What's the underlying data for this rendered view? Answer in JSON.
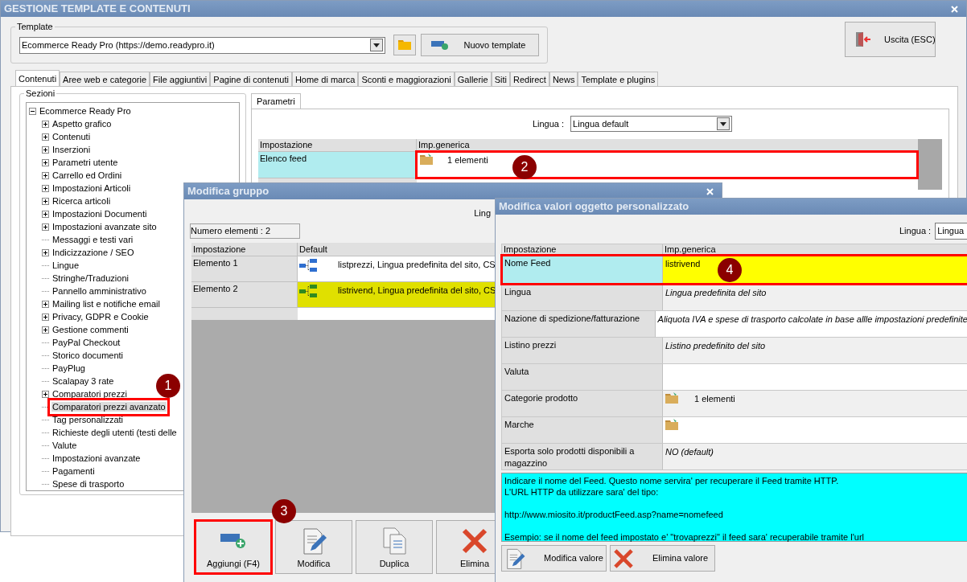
{
  "main_window": {
    "title": "GESTIONE TEMPLATE E CONTENUTI",
    "template": {
      "label": "Template",
      "value": "Ecommerce Ready Pro (https://demo.readypro.it)",
      "new_button": "Nuovo template"
    },
    "exit_button": "Uscita (ESC)",
    "tabs": [
      {
        "label": "Contenuti",
        "selected": true
      },
      {
        "label": "Aree web e categorie",
        "selected": false
      },
      {
        "label": "File aggiuntivi",
        "selected": false
      },
      {
        "label": "Pagine di contenuti",
        "selected": false
      },
      {
        "label": "Home di marca",
        "selected": false
      },
      {
        "label": "Sconti e maggiorazioni",
        "selected": false
      },
      {
        "label": "Gallerie",
        "selected": false
      },
      {
        "label": "Siti",
        "selected": false
      },
      {
        "label": "Redirect",
        "selected": false
      },
      {
        "label": "News",
        "selected": false
      },
      {
        "label": "Template e plugins",
        "selected": false
      }
    ],
    "sections": {
      "label": "Sezioni",
      "tree": {
        "label": "Ecommerce Ready Pro",
        "expanded": true,
        "children": [
          {
            "label": "Aspetto grafico",
            "kind": "branch",
            "selected": false
          },
          {
            "label": "Contenuti",
            "kind": "branch",
            "selected": false
          },
          {
            "label": "Inserzioni",
            "kind": "branch",
            "selected": false
          },
          {
            "label": "Parametri utente",
            "kind": "branch",
            "selected": false
          },
          {
            "label": "Carrello ed Ordini",
            "kind": "branch",
            "selected": false
          },
          {
            "label": "Impostazioni Articoli",
            "kind": "branch",
            "selected": false
          },
          {
            "label": "Ricerca articoli",
            "kind": "branch",
            "selected": false
          },
          {
            "label": "Impostazioni Documenti",
            "kind": "branch",
            "selected": false
          },
          {
            "label": "Impostazioni avanzate sito",
            "kind": "branch",
            "selected": false
          },
          {
            "label": "Messaggi e testi vari",
            "kind": "leaf",
            "selected": false
          },
          {
            "label": "Indicizzazione / SEO",
            "kind": "branch",
            "selected": false
          },
          {
            "label": "Lingue",
            "kind": "leaf",
            "selected": false
          },
          {
            "label": "Stringhe/Traduzioni",
            "kind": "leaf",
            "selected": false
          },
          {
            "label": "Pannello amministrativo",
            "kind": "leaf",
            "selected": false
          },
          {
            "label": "Mailing list e notifiche email",
            "kind": "branch",
            "selected": false
          },
          {
            "label": "Privacy, GDPR e Cookie",
            "kind": "branch",
            "selected": false
          },
          {
            "label": "Gestione commenti",
            "kind": "branch",
            "selected": false
          },
          {
            "label": "PayPal Checkout",
            "kind": "leaf",
            "selected": false
          },
          {
            "label": "Storico documenti",
            "kind": "leaf",
            "selected": false
          },
          {
            "label": "PayPlug",
            "kind": "leaf",
            "selected": false
          },
          {
            "label": "Scalapay 3 rate",
            "kind": "leaf",
            "selected": false
          },
          {
            "label": "Comparatori prezzi",
            "kind": "branch",
            "selected": false
          },
          {
            "label": "Comparatori prezzi avanzato",
            "kind": "leaf",
            "selected": true
          },
          {
            "label": "Tag personalizzati",
            "kind": "leaf",
            "selected": false
          },
          {
            "label": "Richieste degli utenti (testi delle",
            "kind": "leaf",
            "selected": false
          },
          {
            "label": "Valute",
            "kind": "leaf",
            "selected": false
          },
          {
            "label": "Impostazioni avanzate",
            "kind": "leaf",
            "selected": false
          },
          {
            "label": "Pagamenti",
            "kind": "leaf",
            "selected": false
          },
          {
            "label": "Spese di trasporto",
            "kind": "leaf",
            "selected": false
          }
        ]
      }
    },
    "params": {
      "tab": "Parametri",
      "language_label": "Lingua :",
      "language_value": "Lingua default",
      "columns": [
        "Impostazione",
        "Imp.generica"
      ],
      "rows": [
        {
          "setting": "Elenco feed",
          "value": "1 elementi",
          "kind": "list",
          "selected": true
        }
      ]
    }
  },
  "group_dialog": {
    "title": "Modifica gruppo",
    "language_label": "Ling",
    "count": "Numero elementi : 2",
    "columns": [
      "Impostazione",
      "Default"
    ],
    "rows": [
      {
        "setting": "Elemento 1",
        "value": "listprezzi, Lingua predefinita del sito, CS",
        "selected": false
      },
      {
        "setting": "Elemento 2",
        "value": "listrivend, Lingua predefinita del sito, CS",
        "selected": true
      }
    ],
    "buttons": [
      {
        "label": "Aggiungi (F4)",
        "kind": "add"
      },
      {
        "label": "Modifica",
        "kind": "edit"
      },
      {
        "label": "Duplica",
        "kind": "duplicate"
      },
      {
        "label": "Elimina",
        "kind": "delete"
      }
    ]
  },
  "object_dialog": {
    "title": "Modifica valori oggetto personalizzato",
    "language_label": "Lingua :",
    "language_value": "Lingua",
    "columns": [
      "Impostazione",
      "Imp.generica"
    ],
    "rows": [
      {
        "setting": "Nome Feed",
        "value": "listrivend",
        "kind": "text",
        "selected": true
      },
      {
        "setting": "Lingua",
        "value": "Lingua predefinita del sito",
        "kind": "default",
        "selected": false
      },
      {
        "setting": "Nazione di spedizione/fatturazione",
        "value": "Aliquota IVA e spese di trasporto calcolate in base allle impostazioni predefinite",
        "kind": "default",
        "selected": false
      },
      {
        "setting": "Listino prezzi",
        "value": "Listino predefinito del sito",
        "kind": "default",
        "selected": false
      },
      {
        "setting": "Valuta",
        "kind": "text",
        "selected": false
      },
      {
        "setting": "Categorie prodotto",
        "value": "1 elementi",
        "kind": "list",
        "selected": false
      },
      {
        "setting": "Marche",
        "kind": "list",
        "selected": false
      },
      {
        "setting": "Esporta solo prodotti disponibili a magazzino",
        "value": "NO (default)",
        "kind": "default",
        "selected": false
      }
    ],
    "help": [
      "Indicare il nome del Feed. Questo nome servira' per recuperare il Feed tramite HTTP.",
      "L'URL HTTP da utilizzare sara' del tipo:",
      "http://www.miosito.it/productFeed.asp?name=nomefeed",
      "Esempio: se il nome del feed impostato e' \"trovaprezzi\" il feed sara' recuperabile tramite l'url"
    ],
    "buttons": [
      {
        "label": "Modifica valore",
        "kind": "edit"
      },
      {
        "label": "Elimina valore",
        "kind": "delete"
      }
    ]
  },
  "annotations": [
    "1",
    "2",
    "3",
    "4"
  ]
}
